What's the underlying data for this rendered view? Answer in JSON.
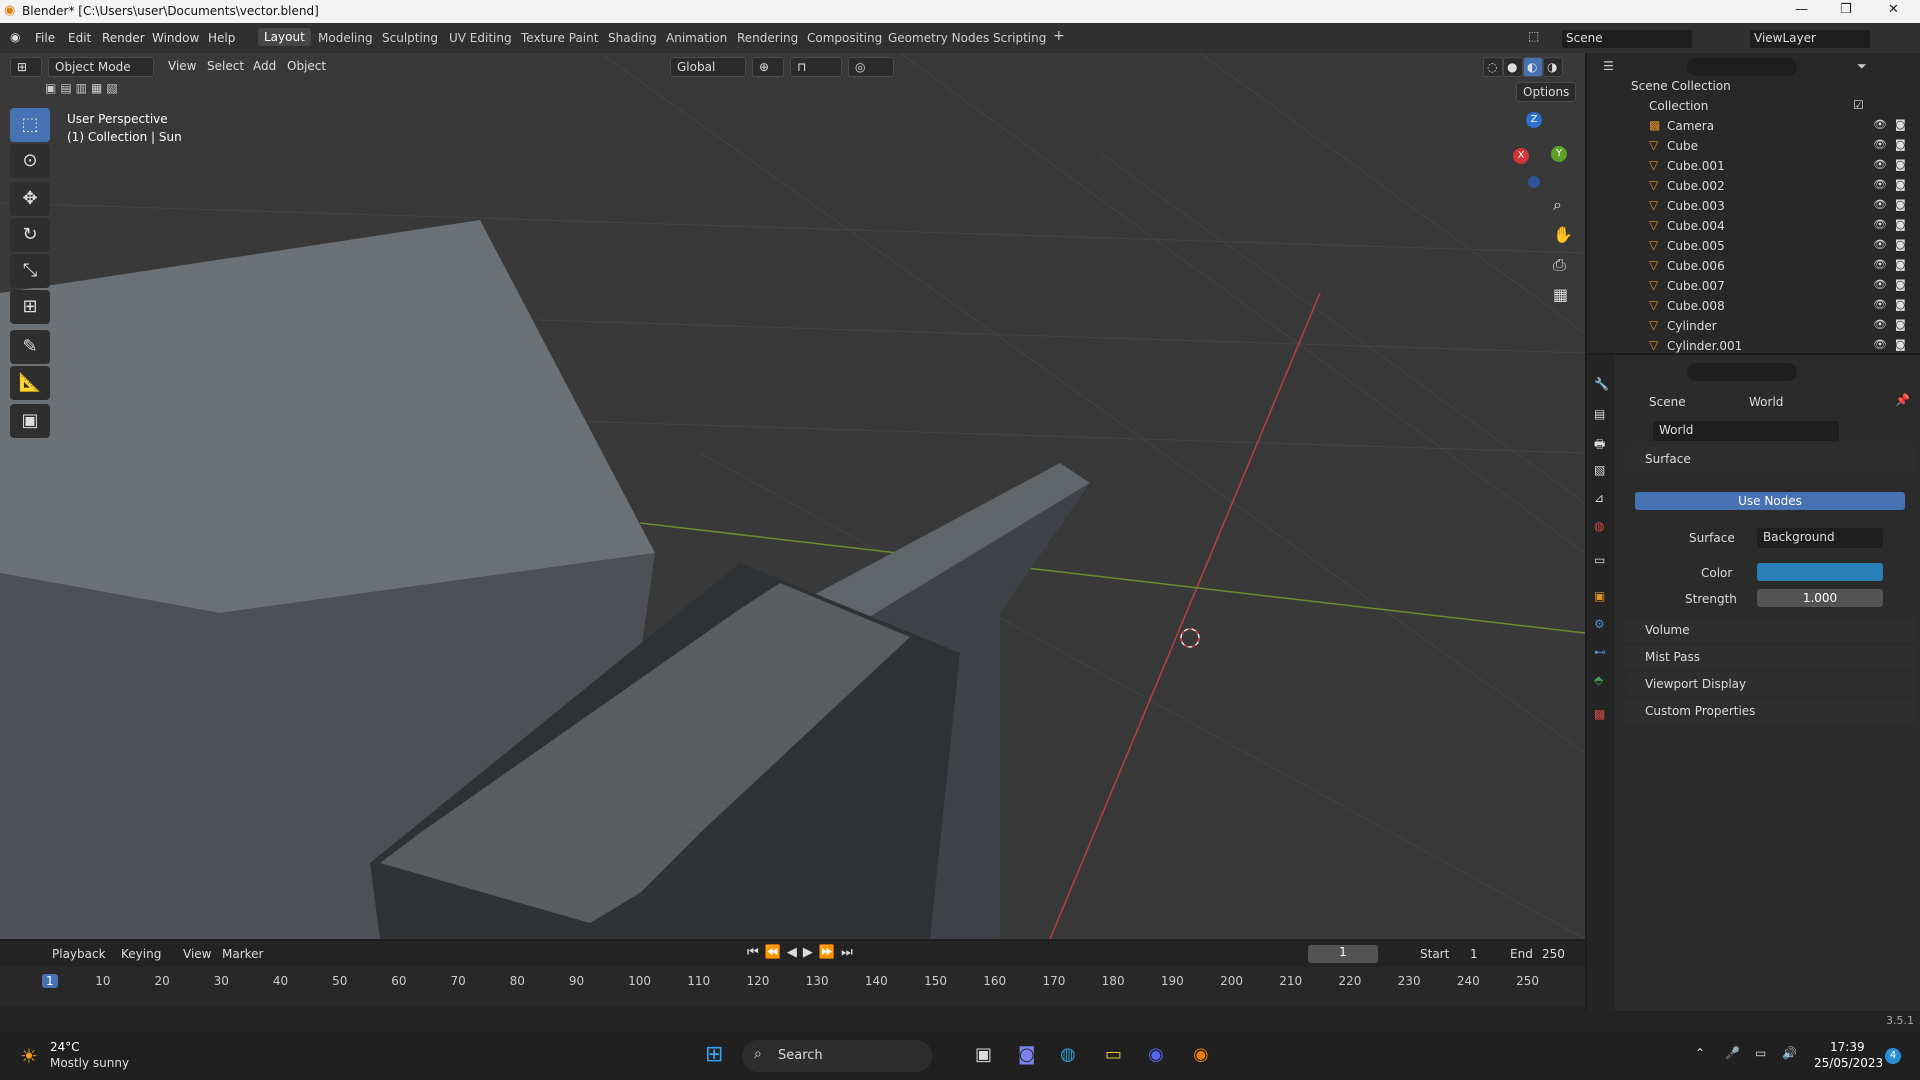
{
  "window": {
    "title": "Blender* [C:\\Users\\user\\Documents\\vector.blend]"
  },
  "menu": [
    "File",
    "Edit",
    "Render",
    "Window",
    "Help"
  ],
  "workspaces": [
    "Layout",
    "Modeling",
    "Sculpting",
    "UV Editing",
    "Texture Paint",
    "Shading",
    "Animation",
    "Rendering",
    "Compositing",
    "Geometry Nodes",
    "Scripting"
  ],
  "scene": {
    "label": "Scene",
    "viewlayer": "ViewLayer"
  },
  "viewport_header": {
    "mode": "Object Mode",
    "menus": [
      "View",
      "Select",
      "Add",
      "Object"
    ],
    "orientation": "Global",
    "options": "Options"
  },
  "viewport_info": {
    "line1": "User Perspective",
    "line2": "(1) Collection | Sun"
  },
  "gizmo": {
    "x": "X",
    "y": "Y",
    "z": "Z"
  },
  "outliner": {
    "root": "Scene Collection",
    "collection": "Collection",
    "items": [
      "Camera",
      "Cube",
      "Cube.001",
      "Cube.002",
      "Cube.003",
      "Cube.004",
      "Cube.005",
      "Cube.006",
      "Cube.007",
      "Cube.008",
      "Cylinder",
      "Cylinder.001"
    ]
  },
  "properties": {
    "breadcrumb_scene": "Scene",
    "breadcrumb_world": "World",
    "world_name": "World",
    "surface_section": "Surface",
    "use_nodes": "Use Nodes",
    "surface_label": "Surface",
    "surface_value": "Background",
    "color_label": "Color",
    "color_value": "#2a7fb8",
    "strength_label": "Strength",
    "strength_value": "1.000",
    "sections": [
      "Volume",
      "Mist Pass",
      "Viewport Display",
      "Custom Properties"
    ]
  },
  "timeline": {
    "menus": [
      "Playback",
      "Keying",
      "View",
      "Marker"
    ],
    "current_frame": "1",
    "start_label": "Start",
    "start": "1",
    "end_label": "End",
    "end": "250",
    "ticks": [
      "1",
      "10",
      "20",
      "30",
      "40",
      "50",
      "60",
      "70",
      "80",
      "90",
      "100",
      "110",
      "120",
      "130",
      "140",
      "150",
      "160",
      "170",
      "180",
      "190",
      "200",
      "210",
      "220",
      "230",
      "240",
      "250"
    ]
  },
  "statusbar": {
    "version": "3.5.1"
  },
  "taskbar": {
    "weather_temp": "24°C",
    "weather_desc": "Mostly sunny",
    "search": "Search",
    "time": "17:39",
    "date": "25/05/2023",
    "notif_count": "4"
  },
  "colors": {
    "accent": "#4772b3",
    "world_color": "#2a7fb8",
    "active_frame": "#4772b3"
  }
}
